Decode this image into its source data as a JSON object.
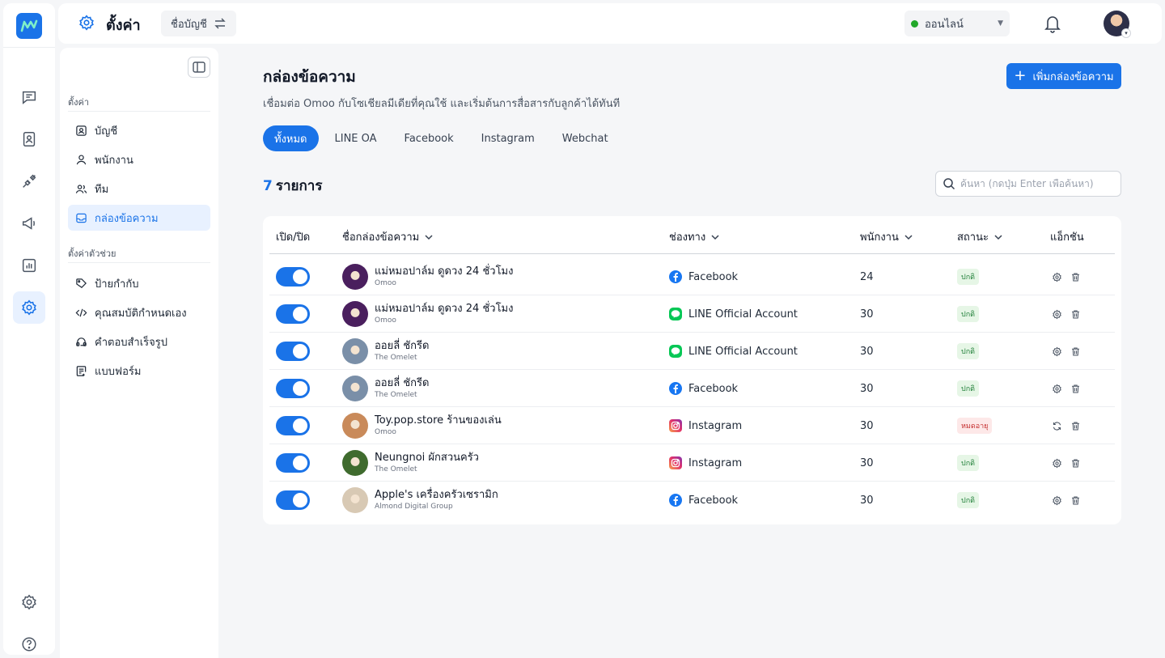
{
  "rail": {
    "items": [
      "chat-icon",
      "contacts-icon",
      "integration-icon",
      "broadcast-icon",
      "report-icon",
      "settings-icon"
    ],
    "bottom": [
      "settings-icon",
      "help-icon"
    ]
  },
  "topbar": {
    "title": "ตั้งค่า",
    "account_label": "ชื่อบัญชี",
    "status": "ออนไลน์"
  },
  "sidebar": {
    "section1": "ตั้งค่า",
    "items1": [
      {
        "label": "บัญชี",
        "icon": "account-icon"
      },
      {
        "label": "พนักงาน",
        "icon": "user-icon"
      },
      {
        "label": "ทีม",
        "icon": "team-icon"
      },
      {
        "label": "กล่องข้อความ",
        "icon": "inbox-icon",
        "active": true
      }
    ],
    "section2": "ตั้งค่าตัวช่วย",
    "items2": [
      {
        "label": "ป้ายกำกับ",
        "icon": "tag-icon"
      },
      {
        "label": "คุณสมบัติกำหนดเอง",
        "icon": "code-icon"
      },
      {
        "label": "คำตอบสำเร็จรูป",
        "icon": "quick-reply-icon"
      },
      {
        "label": "แบบฟอร์ม",
        "icon": "form-icon"
      }
    ]
  },
  "main": {
    "title": "กล่องข้อความ",
    "subtitle": "เชื่อมต่อ Omoo กับโซเชียลมีเดียที่คุณใช้ และเริ่มต้นการสื่อสารกับลูกค้าได้ทันที",
    "add_button": "เพิ่มกล่องข้อความ",
    "tabs": [
      "ทั้งหมด",
      "LINE OA",
      "Facebook",
      "Instagram",
      "Webchat"
    ],
    "count_number": "7",
    "count_label": "รายการ",
    "search_placeholder": "ค้นหา (กดปุ่ม Enter เพื่อค้นหา)"
  },
  "table": {
    "headers": {
      "toggle": "เปิด/ปิด",
      "name": "ชื่อกล่องข้อความ",
      "channel": "ช่องทาง",
      "agents": "พนักงาน",
      "status": "สถานะ",
      "actions": "แอ็กชัน"
    },
    "rows": [
      {
        "name": "แม่หมอปาล์ม ดูดวง 24 ชั่วโมง",
        "org": "Omoo",
        "channel": "Facebook",
        "channel_icon": "facebook-icon",
        "agents": "24",
        "status": "ปกติ",
        "status_type": "ok",
        "avatar_color": "#4a1f5e"
      },
      {
        "name": "แม่หมอปาล์ม ดูดวง 24 ชั่วโมง",
        "org": "Omoo",
        "channel": "LINE Official Account",
        "channel_icon": "line-icon",
        "agents": "30",
        "status": "ปกติ",
        "status_type": "ok",
        "avatar_color": "#4a1f5e"
      },
      {
        "name": "ออยลี่ ชักรีด",
        "org": "The Omelet",
        "channel": "LINE Official Account",
        "channel_icon": "line-icon",
        "agents": "30",
        "status": "ปกติ",
        "status_type": "ok",
        "avatar_color": "#7a8fa8"
      },
      {
        "name": "ออยลี่ ชักรีด",
        "org": "The Omelet",
        "channel": "Facebook",
        "channel_icon": "facebook-icon",
        "agents": "30",
        "status": "ปกติ",
        "status_type": "ok",
        "avatar_color": "#7a8fa8"
      },
      {
        "name": "Toy.pop.store ร้านของเล่น",
        "org": "Omoo",
        "channel": "Instagram",
        "channel_icon": "instagram-icon",
        "agents": "30",
        "status": "หมดอายุ",
        "status_type": "exp",
        "avatar_color": "#c98a5a"
      },
      {
        "name": "Neungnoi ผักสวนครัว",
        "org": "The Omelet",
        "channel": "Instagram",
        "channel_icon": "instagram-icon",
        "agents": "30",
        "status": "ปกติ",
        "status_type": "ok",
        "avatar_color": "#3f6b2e"
      },
      {
        "name": "Apple's เครื่องครัวเซรามิก",
        "org": "Almond Digital Group",
        "channel": "Facebook",
        "channel_icon": "facebook-icon",
        "agents": "30",
        "status": "ปกติ",
        "status_type": "ok",
        "avatar_color": "#d8c9b4"
      }
    ]
  },
  "colors": {
    "accent": "#1a73e8",
    "facebook": "#1877f2",
    "line": "#06c755",
    "online": "#22a82a"
  }
}
